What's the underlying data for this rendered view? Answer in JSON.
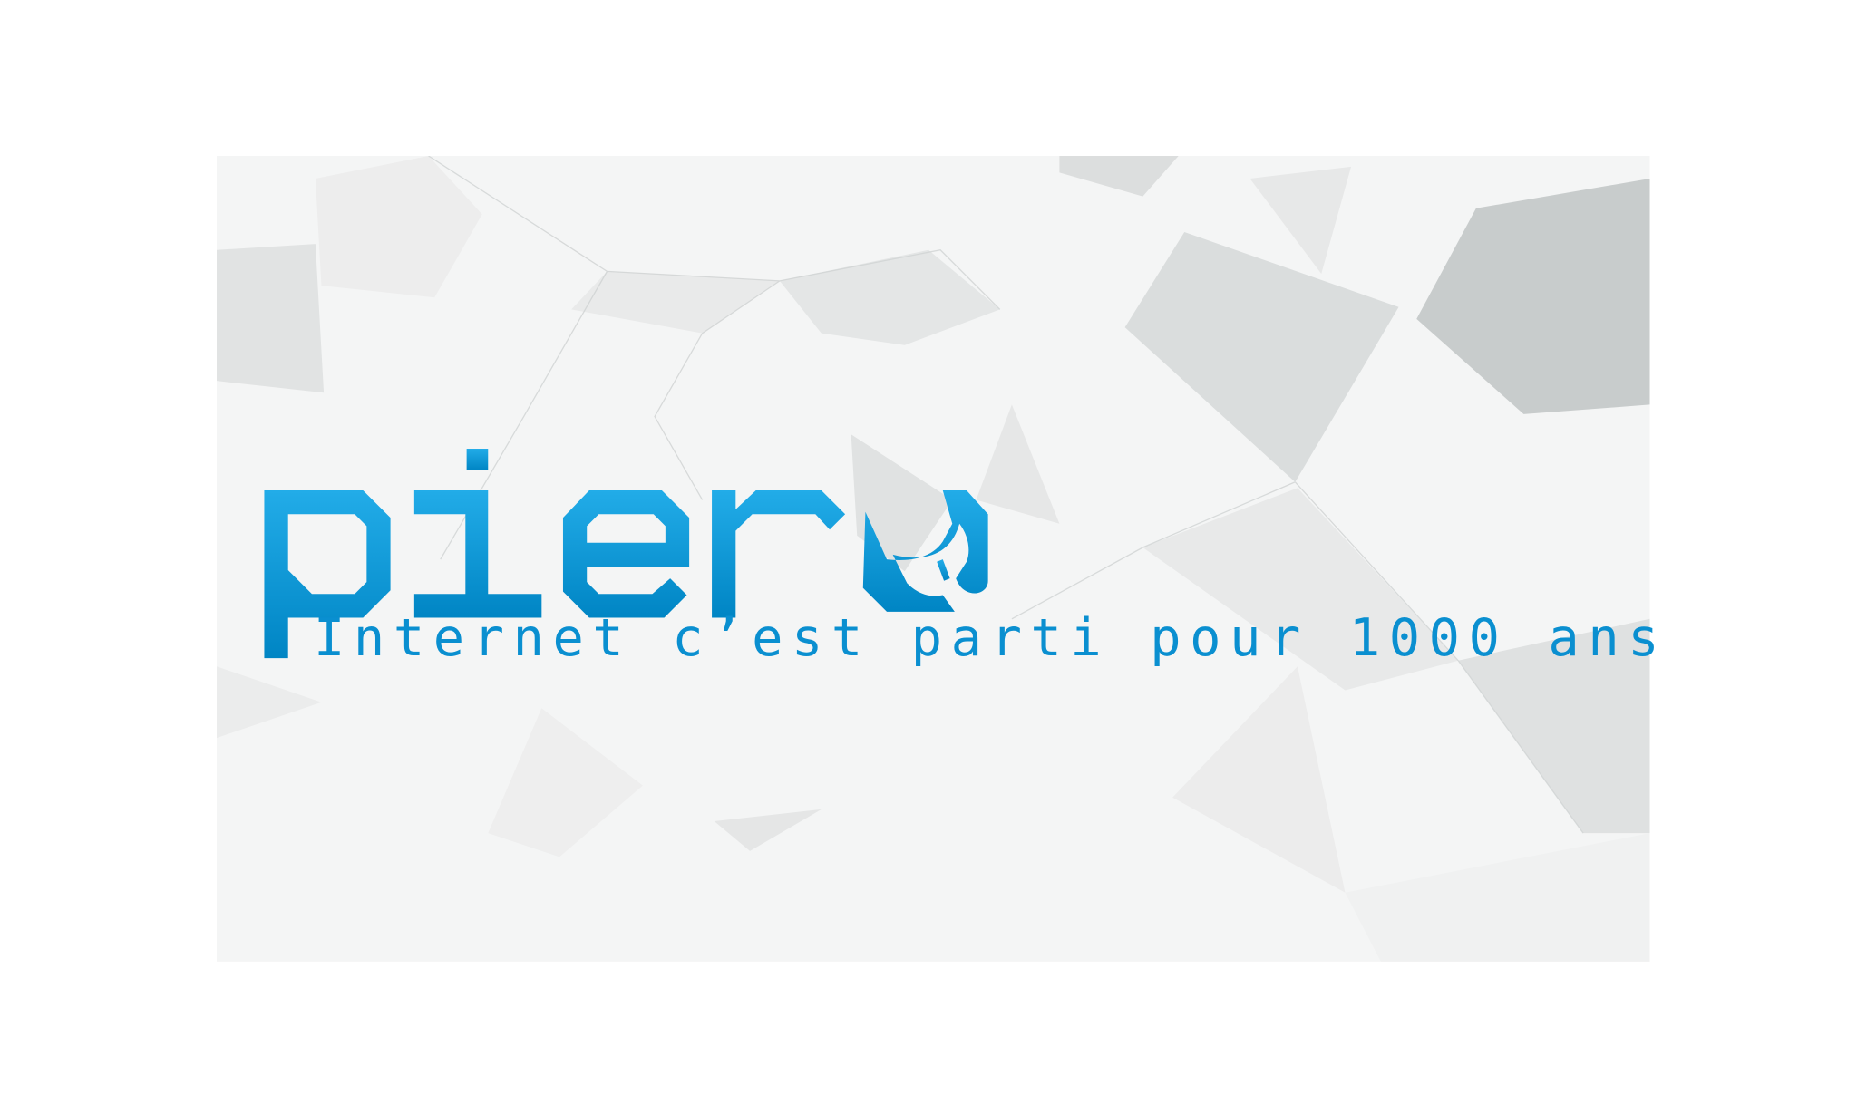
{
  "banner": {
    "logo_text": "piero",
    "tagline": "Internet c’est parti pour 1000 ans",
    "colors": {
      "brand_top": "#22acE8",
      "brand_bottom": "#0085c4",
      "background": "#f3f4f4"
    }
  }
}
